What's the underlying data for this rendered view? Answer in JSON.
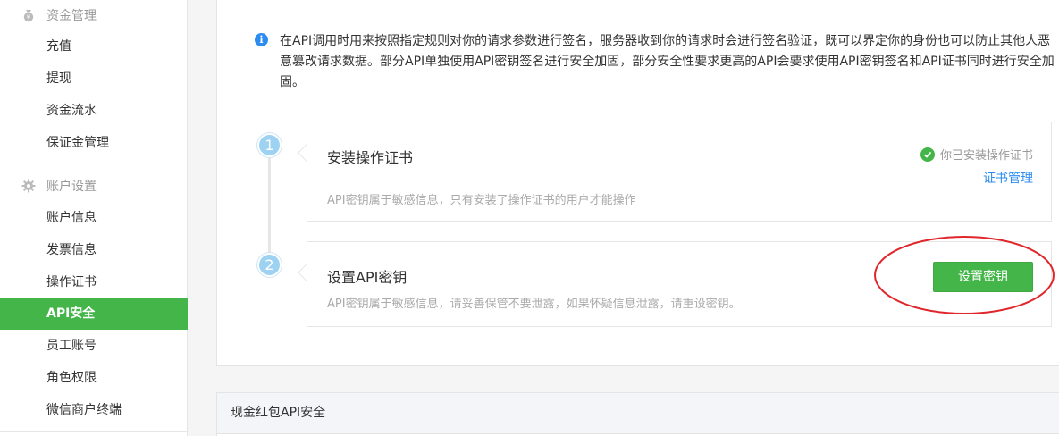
{
  "sidebar": {
    "fund_group": {
      "label": "资金管理",
      "icon": "money-bag-icon"
    },
    "fund_items": [
      {
        "label": "充值"
      },
      {
        "label": "提现"
      },
      {
        "label": "资金流水"
      },
      {
        "label": "保证金管理"
      }
    ],
    "account_group": {
      "label": "账户设置",
      "icon": "gear-icon"
    },
    "account_items": [
      {
        "label": "账户信息"
      },
      {
        "label": "发票信息"
      },
      {
        "label": "操作证书"
      },
      {
        "label": "API安全",
        "active": true
      },
      {
        "label": "员工账号"
      },
      {
        "label": "角色权限"
      },
      {
        "label": "微信商户终端"
      }
    ]
  },
  "notice": {
    "icon": "info-icon",
    "text": "在API调用时用来按照指定规则对你的请求参数进行签名，服务器收到你的请求时会进行签名验证，既可以界定你的身份也可以防止其他人恶意篡改请求数据。部分API单独使用API密钥签名进行安全加固，部分安全性要求更高的API会要求使用API密钥签名和API证书同时进行安全加固。"
  },
  "steps": [
    {
      "number": "1",
      "title": "安装操作证书",
      "desc": "API密钥属于敏感信息，只有安装了操作证书的用户才能操作",
      "status": "你已安装操作证书",
      "link": "证书管理"
    },
    {
      "number": "2",
      "title": "设置API密钥",
      "desc": "API密钥属于敏感信息，请妥善保管不要泄露，如果怀疑信息泄露，请重设密钥。",
      "button": "设置密钥"
    }
  ],
  "section2": {
    "title": "现金红包API安全"
  },
  "colors": {
    "accent": "#44b549",
    "link": "#2d8cf0",
    "highlight_circle": "#e0262b"
  }
}
